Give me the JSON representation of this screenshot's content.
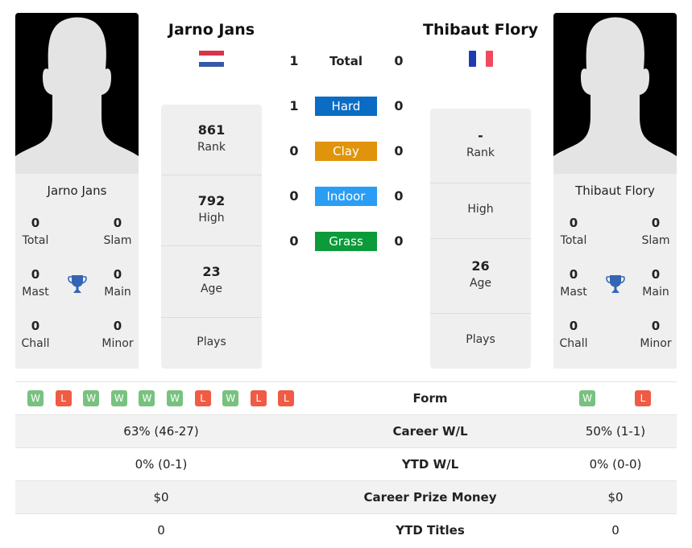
{
  "colors": {
    "hard": "#0a6cc4",
    "clay": "#e0940c",
    "indoor": "#2a9df4",
    "grass": "#0c9a3a",
    "win": "#78c27f",
    "loss": "#ef5b44",
    "trophy": "#3465b4"
  },
  "player1": {
    "name": "Jarno Jans",
    "flag": "netherlands-flag",
    "titles": {
      "total": "0",
      "total_label": "Total",
      "slam": "0",
      "slam_label": "Slam",
      "mast": "0",
      "mast_label": "Mast",
      "main": "0",
      "main_label": "Main",
      "chall": "0",
      "chall_label": "Chall",
      "minor": "0",
      "minor_label": "Minor"
    },
    "stats": [
      {
        "value": "861",
        "label": "Rank"
      },
      {
        "value": "792",
        "label": "High"
      },
      {
        "value": "23",
        "label": "Age"
      },
      {
        "value": "",
        "label": "Plays"
      }
    ],
    "form": [
      "W",
      "L",
      "W",
      "W",
      "W",
      "W",
      "L",
      "W",
      "L",
      "L"
    ],
    "career_wl": "63% (46-27)",
    "ytd_wl": "0% (0-1)",
    "prize_money": "$0",
    "ytd_titles": "0"
  },
  "player2": {
    "name": "Thibaut Flory",
    "flag": "france-flag",
    "titles": {
      "total": "0",
      "total_label": "Total",
      "slam": "0",
      "slam_label": "Slam",
      "mast": "0",
      "mast_label": "Mast",
      "main": "0",
      "main_label": "Main",
      "chall": "0",
      "chall_label": "Chall",
      "minor": "0",
      "minor_label": "Minor"
    },
    "stats": [
      {
        "value": "-",
        "label": "Rank"
      },
      {
        "value": "",
        "label": "High"
      },
      {
        "value": "26",
        "label": "Age"
      },
      {
        "value": "",
        "label": "Plays"
      }
    ],
    "form": [
      "W",
      "L"
    ],
    "career_wl": "50% (1-1)",
    "ytd_wl": "0% (0-0)",
    "prize_money": "$0",
    "ytd_titles": "0"
  },
  "h2h": [
    {
      "label": "Total",
      "p1": "1",
      "p2": "0",
      "surface": "total"
    },
    {
      "label": "Hard",
      "p1": "1",
      "p2": "0",
      "surface": "hard"
    },
    {
      "label": "Clay",
      "p1": "0",
      "p2": "0",
      "surface": "clay"
    },
    {
      "label": "Indoor",
      "p1": "0",
      "p2": "0",
      "surface": "indoor"
    },
    {
      "label": "Grass",
      "p1": "0",
      "p2": "0",
      "surface": "grass"
    }
  ],
  "table_labels": {
    "form": "Form",
    "career_wl": "Career W/L",
    "ytd_wl": "YTD W/L",
    "prize_money": "Career Prize Money",
    "ytd_titles": "YTD Titles"
  }
}
